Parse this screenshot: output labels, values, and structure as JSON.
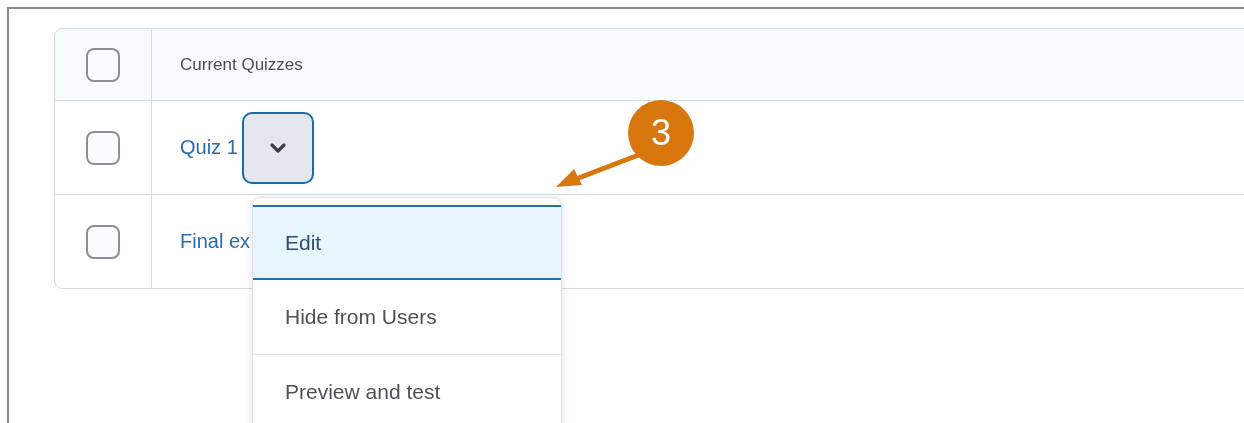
{
  "table": {
    "header": {
      "label": "Current Quizzes",
      "checked": false
    },
    "rows": [
      {
        "title": "Quiz 1",
        "checked": false,
        "has_menu_button": true
      },
      {
        "title": "Final ex",
        "checked": false,
        "has_menu_button": false
      }
    ]
  },
  "menu": {
    "items": [
      {
        "label": "Edit",
        "selected": true
      },
      {
        "label": "Hide from Users",
        "selected": false
      },
      {
        "label": "Preview and test",
        "selected": false
      }
    ]
  },
  "callout": {
    "number": "3"
  }
}
